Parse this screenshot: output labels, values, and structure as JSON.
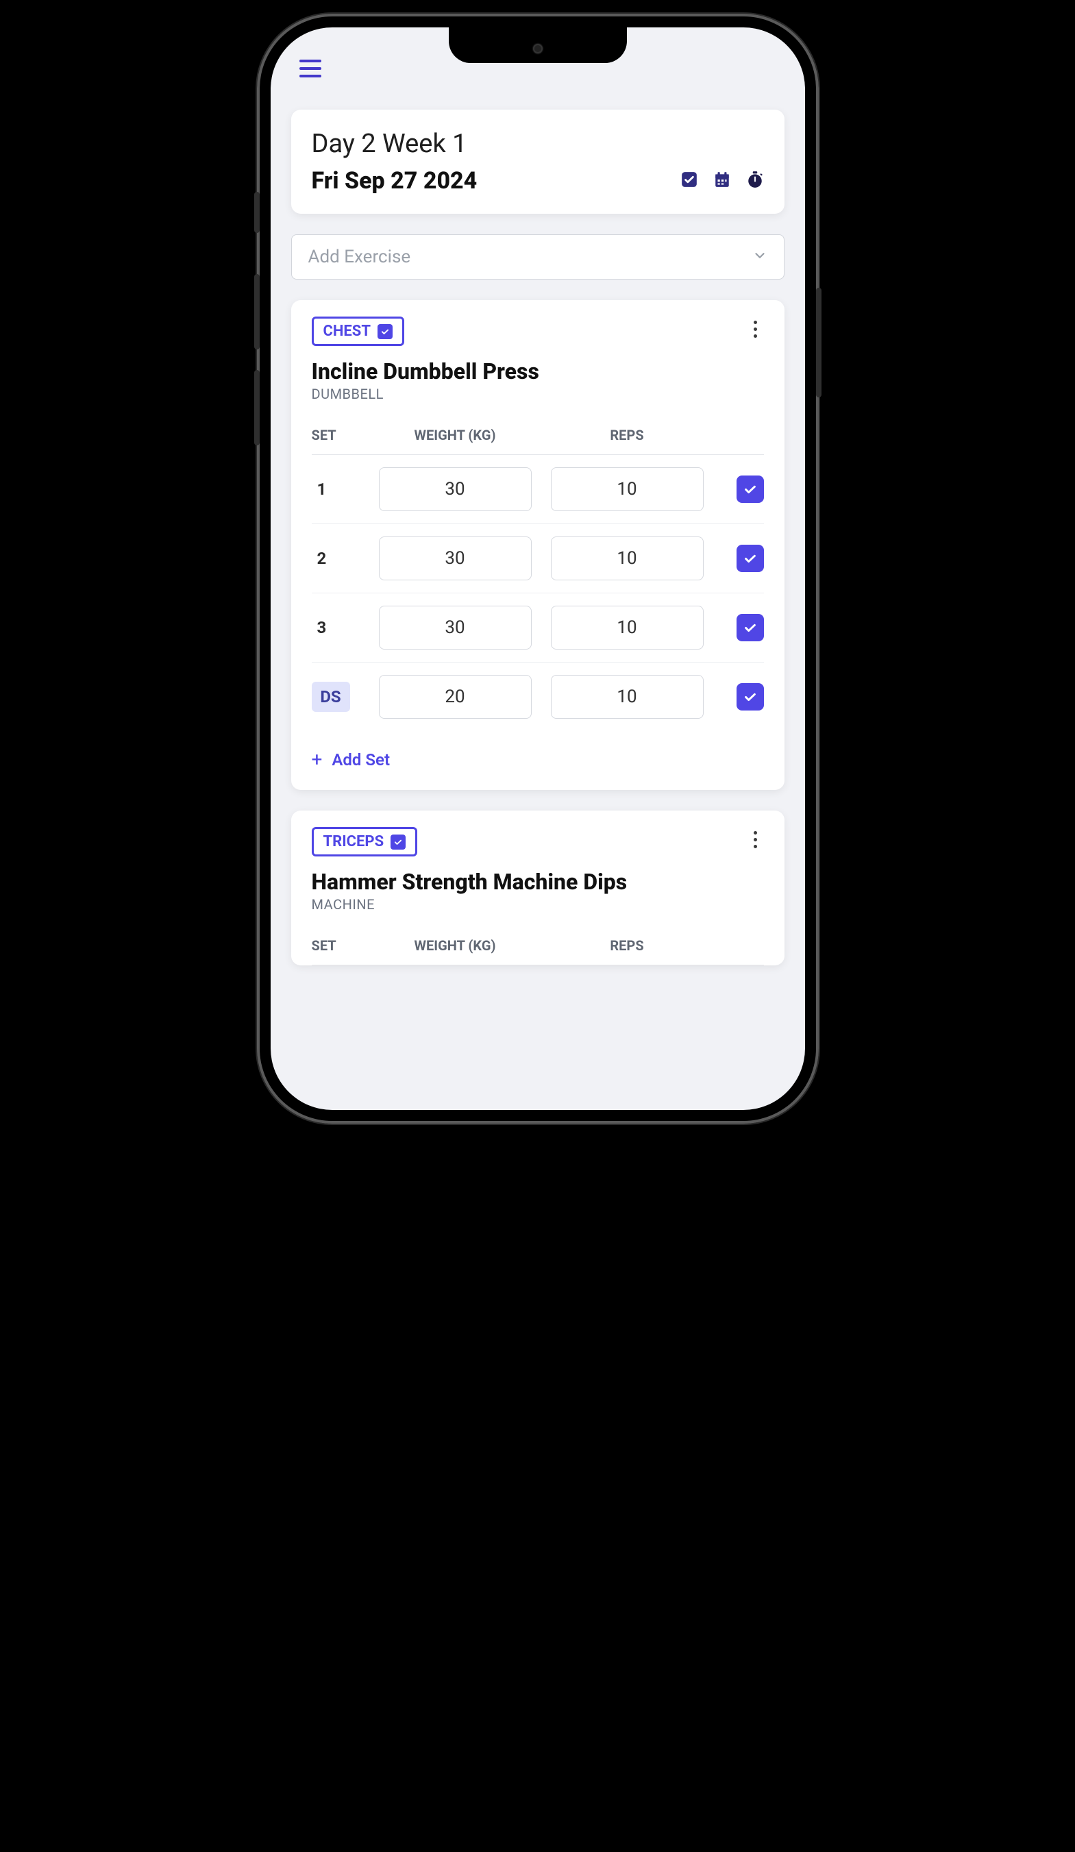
{
  "header": {
    "day_title": "Day 2 Week 1",
    "date_text": "Fri Sep 27 2024"
  },
  "add_exercise_placeholder": "Add Exercise",
  "table_headers": {
    "set": "SET",
    "weight": "WEIGHT (KG)",
    "reps": "REPS"
  },
  "add_set_label": "Add Set",
  "exercises": [
    {
      "badge": "CHEST",
      "name": "Incline Dumbbell Press",
      "equipment": "DUMBBELL",
      "sets": [
        {
          "label": "1",
          "weight": "30",
          "reps": "10",
          "ds": false
        },
        {
          "label": "2",
          "weight": "30",
          "reps": "10",
          "ds": false
        },
        {
          "label": "3",
          "weight": "30",
          "reps": "10",
          "ds": false
        },
        {
          "label": "DS",
          "weight": "20",
          "reps": "10",
          "ds": true
        }
      ]
    },
    {
      "badge": "TRICEPS",
      "name": "Hammer Strength Machine Dips",
      "equipment": "MACHINE",
      "sets": []
    }
  ]
}
